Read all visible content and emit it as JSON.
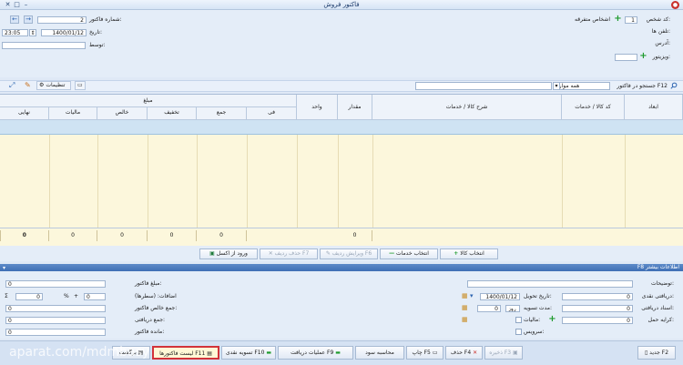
{
  "window": {
    "title": "فاکتور فروش"
  },
  "header": {
    "code_label": "کد شخص:",
    "code_value": "1",
    "code_name": "اشخاص متفرقه",
    "phone_label": "تلفن ها:",
    "address_label": "آدرس:",
    "visitor_label": "ویزیتور:",
    "invoice_no_label": "شماره فاکتور:",
    "invoice_no": "2",
    "date_label": "تاریخ:",
    "date_value": "1400/01/12",
    "time_value": "23:05",
    "by_label": "توسط:"
  },
  "toolbar": {
    "search_label": "جستجو در فاکتور F12",
    "search_filter": "همه موارد",
    "settings_label": "تنظیمات"
  },
  "grid": {
    "headers": {
      "row": "ابعاد",
      "code": "کد کالا / خدمات",
      "desc": "شرح کالا / خدمات",
      "qty": "مقدار",
      "unit": "واحد",
      "amount_group": "مبلغ",
      "fee": "فی",
      "total": "جمع",
      "discount": "تخفیف",
      "net": "خالص",
      "tax": "مالیات",
      "final": "نهایی"
    },
    "totals": {
      "qty": "0",
      "fee": "0",
      "total": "0",
      "discount": "0",
      "net": "0",
      "tax": "0",
      "final": "0"
    }
  },
  "actions": {
    "select_goods": "انتخاب کالا",
    "select_services": "انتخاب خدمات",
    "edit_row": "ویرایش ردیف F6",
    "delete_row": "حذف ردیف F7",
    "import_excel": "ورود از اکسل"
  },
  "more_info": {
    "title": "F8 اطلاعات بیشتر",
    "description_label": "توضیحات:",
    "cash_label": "دریافتی نقدی:",
    "cash_value": "0",
    "cheque_label": "اسناد دریافتی:",
    "cheque_value": "0",
    "transport_label": "کرایه حمل:",
    "transport_value": "0",
    "delivery_date_label": "تاریخ تحویل:",
    "delivery_date": "1400/01/12",
    "term_label": "مدت تسویه:",
    "term_value": "0",
    "term_unit": "روز",
    "tax_label": "مالیات:",
    "service_label": "سرویس:",
    "invoice_amount_label": "مبلغ فاکتور:",
    "invoice_amount": "0",
    "additions_label": "اضافات: (سطرها)",
    "additions_value": "0",
    "pct_value": "0",
    "pct_sign": "%",
    "plus_sign": "+",
    "sigma": "Σ",
    "net_total_label": "جمع خالص فاکتور:",
    "net_total": "0",
    "received_total_label": "جمع دریافتی:",
    "received_total": "0",
    "remaining_label": "مانده فاکتور:",
    "remaining": "0"
  },
  "footer": {
    "new": "جدید F2",
    "save": "ذخیره F3",
    "delete": "حذف F4",
    "print": "چاپ F5",
    "profit": "محاسبه سود",
    "receive_ops": "عملیات دریافت F9",
    "cash_settle": "تسویه نقدی F10",
    "list": "لیست فاکتورها F11",
    "back": "برگشت"
  },
  "watermark": "aparat.com/mdmbasy"
}
